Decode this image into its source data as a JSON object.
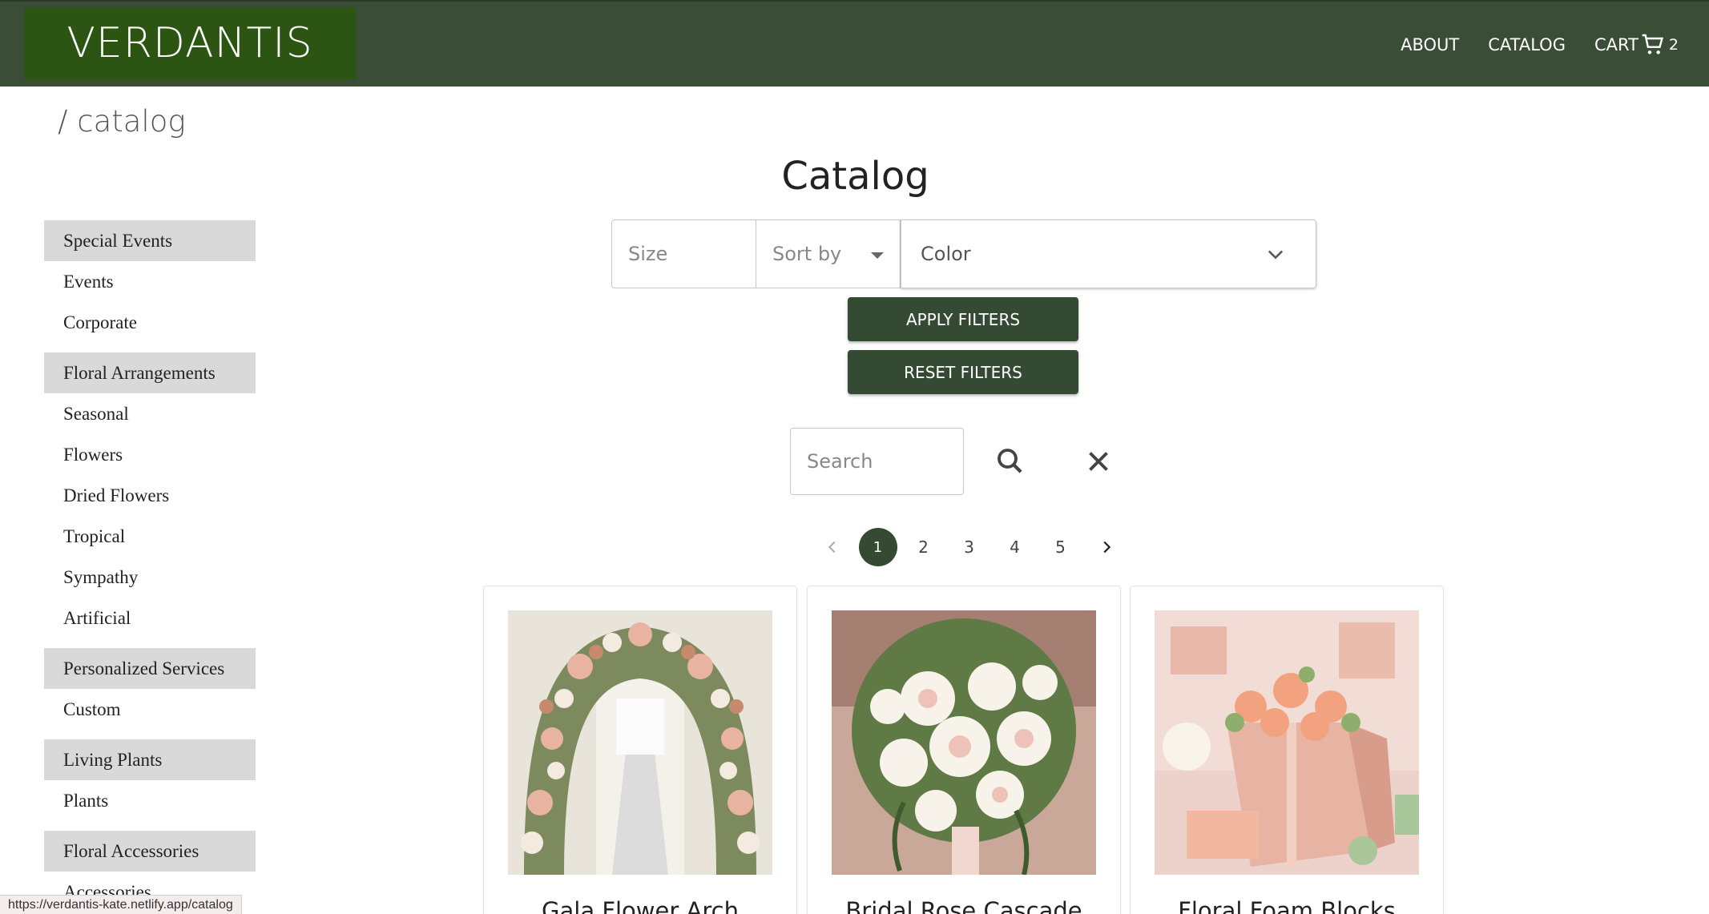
{
  "header": {
    "logo": "VERDANTIS",
    "nav": {
      "about": "ABOUT",
      "catalog": "CATALOG",
      "cart": "CART",
      "cart_count": "2"
    }
  },
  "breadcrumb": "/ catalog",
  "page_title": "Catalog",
  "sidebar": {
    "groups": [
      {
        "title": "Special Events",
        "items": [
          "Events",
          "Corporate"
        ]
      },
      {
        "title": "Floral Arrangements",
        "items": [
          "Seasonal",
          "Flowers",
          "Dried Flowers",
          "Tropical",
          "Sympathy",
          "Artificial"
        ]
      },
      {
        "title": "Personalized Services",
        "items": [
          "Custom"
        ]
      },
      {
        "title": "Living Plants",
        "items": [
          "Plants"
        ]
      },
      {
        "title": "Floral Accessories",
        "items": [
          "Accessories"
        ]
      }
    ]
  },
  "filters": {
    "size_placeholder": "Size",
    "sort_placeholder": "Sort by",
    "color_placeholder": "Color",
    "apply_label": "APPLY FILTERS",
    "reset_label": "RESET FILTERS"
  },
  "search": {
    "placeholder": "Search"
  },
  "pagination": {
    "pages": [
      "1",
      "2",
      "3",
      "4",
      "5"
    ],
    "current": "1"
  },
  "products": [
    {
      "title": "Gala Flower Arch"
    },
    {
      "title": "Bridal Rose Cascade"
    },
    {
      "title": "Floral Foam Blocks"
    }
  ],
  "status_url": "https://verdantis-kate.netlify.app/catalog",
  "colors": {
    "header": "#3a4d37",
    "logo_bg": "#2c5514",
    "button": "#354a33",
    "category_bg": "#d9d9d9"
  }
}
